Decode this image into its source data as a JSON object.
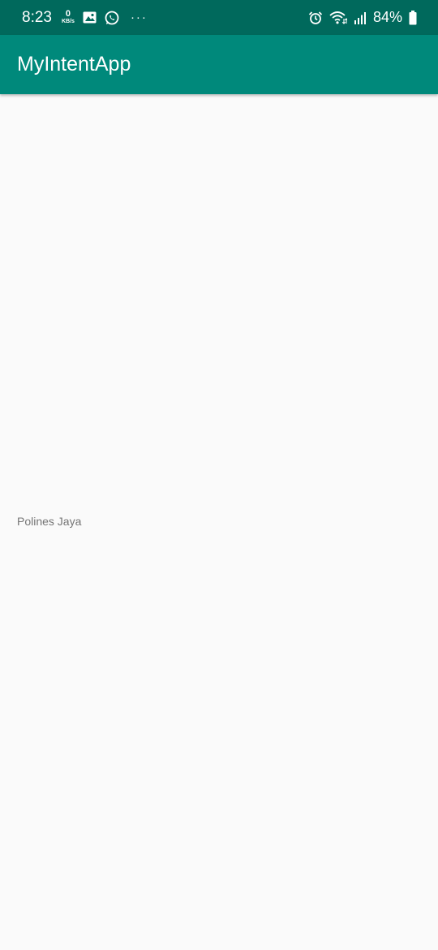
{
  "status_bar": {
    "time": "8:23",
    "network_speed_value": "0",
    "network_speed_unit": "KB/s",
    "more_indicator": "···",
    "battery_percent": "84%",
    "icons": [
      "gallery-icon",
      "whatsapp-icon",
      "alarm-icon",
      "wifi-icon",
      "signal-icon",
      "battery-icon"
    ]
  },
  "app_bar": {
    "title": "MyIntentApp"
  },
  "main": {
    "received_text": "Polines Jaya"
  },
  "colors": {
    "status_bar_bg": "#00695c",
    "app_bar_bg": "#00897b",
    "background": "#fafafa",
    "body_text": "#757575"
  }
}
